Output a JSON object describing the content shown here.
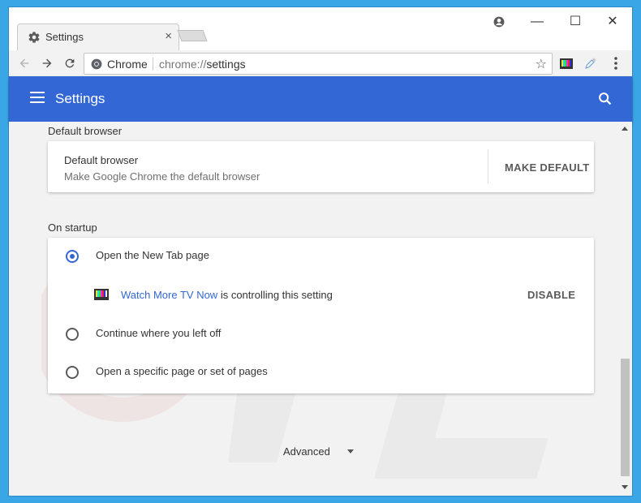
{
  "tab": {
    "title": "Settings",
    "icon": "gear-icon",
    "close": "×"
  },
  "window_controls": {
    "account": "account-icon",
    "minimize": "—",
    "maximize": "☐",
    "close": "✕"
  },
  "toolbar": {
    "omnibox_chip": "Chrome",
    "url_scheme": "chrome://",
    "url_path": "settings",
    "star": "☆"
  },
  "header": {
    "title": "Settings"
  },
  "default_browser": {
    "section_title": "Default browser",
    "label": "Default browser",
    "sublabel": "Make Google Chrome the default browser",
    "button": "MAKE DEFAULT"
  },
  "on_startup": {
    "section_title": "On startup",
    "options": [
      {
        "label": "Open the New Tab page",
        "checked": true
      },
      {
        "label": "Continue where you left off",
        "checked": false
      },
      {
        "label": "Open a specific page or set of pages",
        "checked": false
      }
    ],
    "extension": {
      "name": "Watch More TV Now",
      "suffix": " is controlling this setting",
      "button": "DISABLE"
    }
  },
  "advanced": {
    "label": "Advanced"
  },
  "colors": {
    "accent": "#3367d6",
    "header": "#3367d6",
    "frame": "#3ba6e6"
  }
}
